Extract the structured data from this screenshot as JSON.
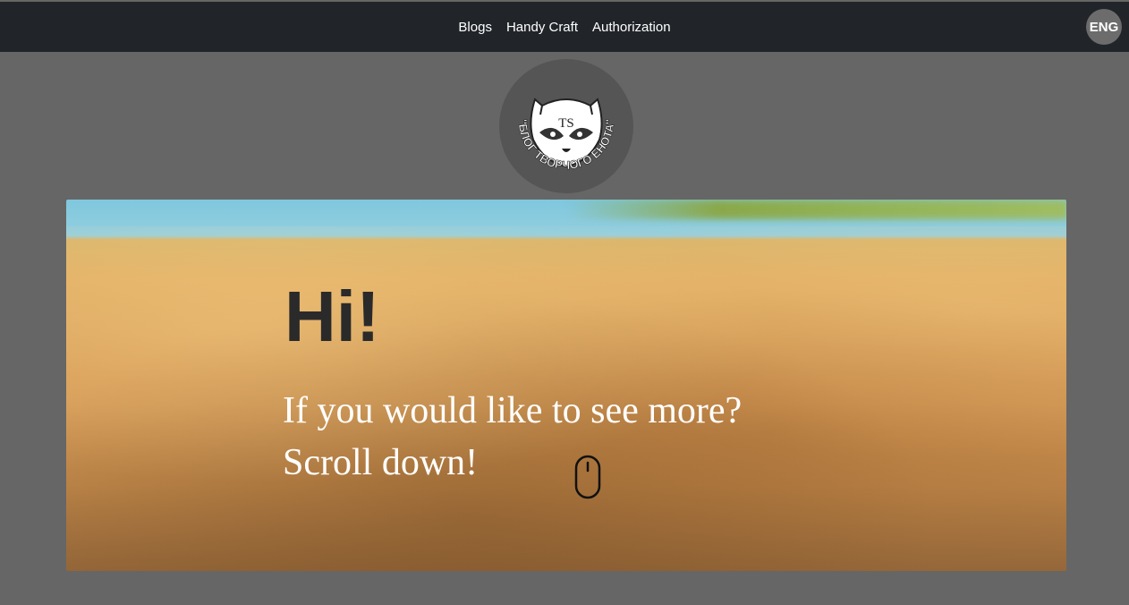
{
  "nav": {
    "items": [
      {
        "label": "Blogs"
      },
      {
        "label": "Handy Craft"
      },
      {
        "label": "Authorization"
      }
    ],
    "lang": "ENG"
  },
  "logo": {
    "icon": "raccoon-logo",
    "monogram": "TS",
    "text": "\"БЛОГ ТВОРЧОГО ЕНОТА\""
  },
  "hero": {
    "title": "Hi!",
    "line1": "If you would like to see more?",
    "line2": "Scroll down!",
    "scroll_icon": "mouse-icon"
  },
  "colors": {
    "navbar": "#212529",
    "page_bg": "#666666",
    "logo_bg": "#555555",
    "title": "#2a2a2a",
    "subtitle": "#ffffff"
  }
}
